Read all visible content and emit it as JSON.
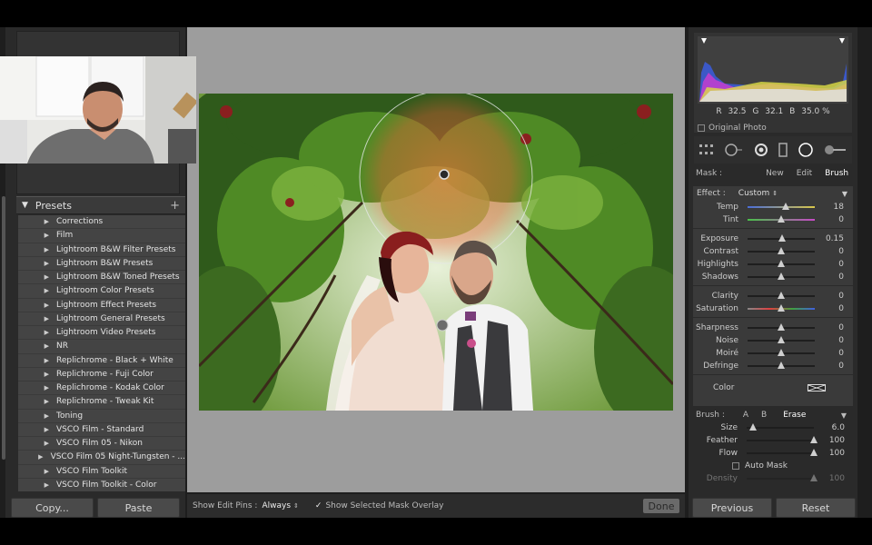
{
  "left_panel": {
    "presets_title": "Presets",
    "presets_add": "+",
    "presets": [
      "Corrections",
      "Film",
      "Lightroom B&W Filter Presets",
      "Lightroom B&W Presets",
      "Lightroom B&W Toned Presets",
      "Lightroom Color Presets",
      "Lightroom Effect Presets",
      "Lightroom General Presets",
      "Lightroom Video Presets",
      "NR",
      "Replichrome - Black + White",
      "Replichrome - Fuji Color",
      "Replichrome - Kodak Color",
      "Replichrome - Tweak Kit",
      "Toning",
      "VSCO Film - Standard",
      "VSCO Film 05 - Nikon",
      "VSCO Film 05 Night-Tungsten - ...",
      "VSCO Film Toolkit",
      "VSCO Film Toolkit - Color"
    ],
    "copy_label": "Copy...",
    "paste_label": "Paste"
  },
  "toolbar": {
    "show_edit_pins_label": "Show Edit Pins :",
    "show_edit_pins_value": "Always",
    "overlay_label": "Show Selected Mask Overlay",
    "done_label": "Done"
  },
  "histogram": {
    "r_label": "R",
    "r_value": "32.5",
    "g_label": "G",
    "g_value": "32.1",
    "b_label": "B",
    "b_value": "35.0 %",
    "original_photo": "Original Photo"
  },
  "mask": {
    "label": "Mask :",
    "new": "New",
    "edit": "Edit",
    "brush": "Brush"
  },
  "effect": {
    "label": "Effect :",
    "value": "Custom",
    "sliders_a": [
      {
        "label": "Temp",
        "value": "18",
        "pos": 0.57
      },
      {
        "label": "Tint",
        "value": "0",
        "pos": 0.5
      }
    ],
    "sliders_b": [
      {
        "label": "Exposure",
        "value": "0.15",
        "pos": 0.52
      },
      {
        "label": "Contrast",
        "value": "0",
        "pos": 0.5
      },
      {
        "label": "Highlights",
        "value": "0",
        "pos": 0.5
      },
      {
        "label": "Shadows",
        "value": "0",
        "pos": 0.5
      }
    ],
    "sliders_c": [
      {
        "label": "Clarity",
        "value": "0",
        "pos": 0.5
      },
      {
        "label": "Saturation",
        "value": "0",
        "pos": 0.5
      }
    ],
    "sliders_d": [
      {
        "label": "Sharpness",
        "value": "0",
        "pos": 0.5
      },
      {
        "label": "Noise",
        "value": "0",
        "pos": 0.5
      },
      {
        "label": "Moiré",
        "value": "0",
        "pos": 0.5
      },
      {
        "label": "Defringe",
        "value": "0",
        "pos": 0.5
      }
    ],
    "color_label": "Color"
  },
  "brush": {
    "label": "Brush :",
    "a": "A",
    "b": "B",
    "erase": "Erase",
    "sliders": [
      {
        "label": "Size",
        "value": "6.0",
        "pos": 0.1
      },
      {
        "label": "Feather",
        "value": "100",
        "pos": 1.0
      },
      {
        "label": "Flow",
        "value": "100",
        "pos": 1.0
      }
    ],
    "auto_mask": "Auto Mask",
    "density_label": "Density",
    "density_value": "100"
  },
  "right_bottom": {
    "previous": "Previous",
    "reset": "Reset"
  },
  "colors": {
    "accent_thumb": "#cfcfcf",
    "panel_bg": "#2a2a2a",
    "canvas_bg": "#9d9d9d"
  }
}
